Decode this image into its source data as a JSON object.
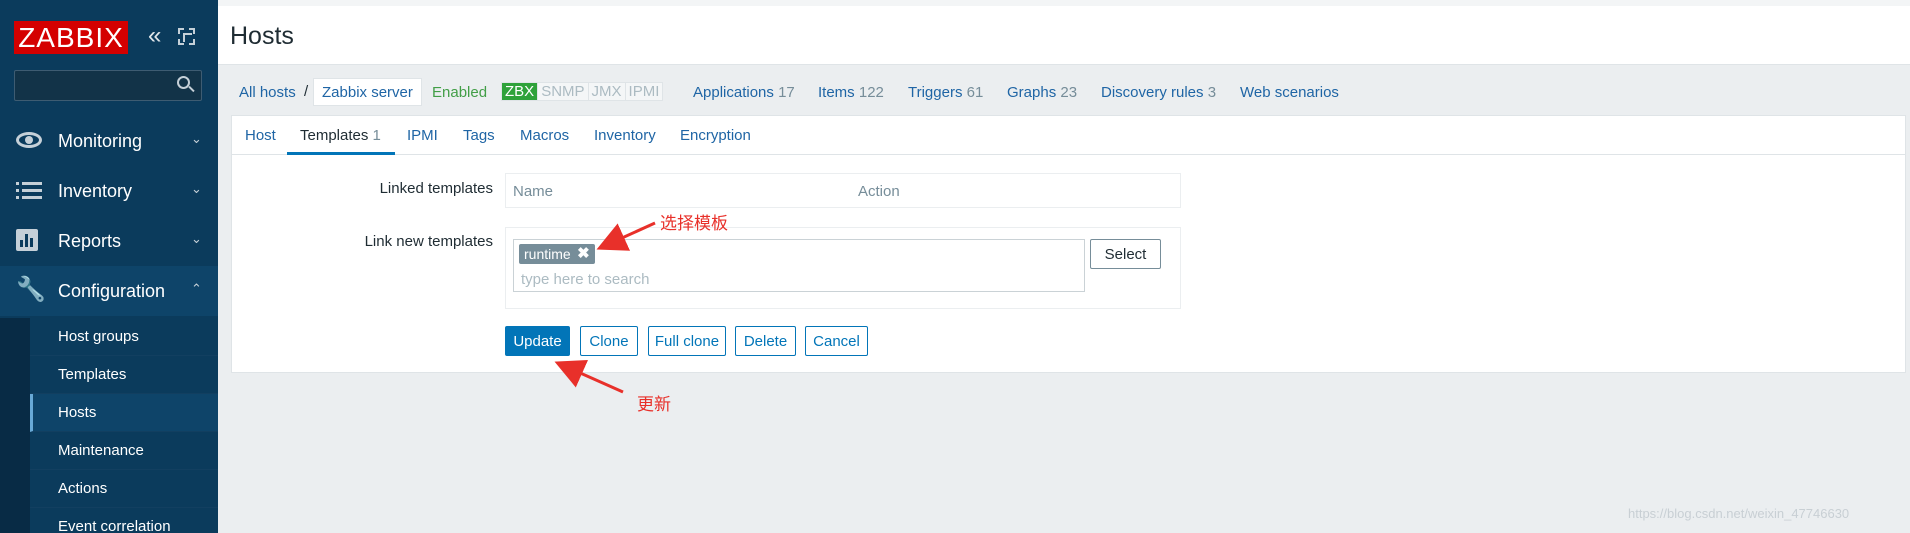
{
  "logo": "ZABBIX",
  "sidebar": {
    "menu": [
      {
        "label": "Monitoring",
        "chevron": "⌄"
      },
      {
        "label": "Inventory",
        "chevron": "⌄"
      },
      {
        "label": "Reports",
        "chevron": "⌄"
      },
      {
        "label": "Configuration",
        "chevron": "⌃"
      }
    ],
    "submenu": [
      "Host groups",
      "Templates",
      "Hosts",
      "Maintenance",
      "Actions",
      "Event correlation"
    ]
  },
  "header": {
    "title": "Hosts"
  },
  "hostnav": {
    "all_hosts": "All hosts",
    "separator": "/",
    "current": "Zabbix server",
    "status": "Enabled",
    "availability": [
      "ZBX",
      "SNMP",
      "JMX",
      "IPMI"
    ],
    "links": [
      {
        "label": "Applications",
        "count": "17"
      },
      {
        "label": "Items",
        "count": "122"
      },
      {
        "label": "Triggers",
        "count": "61"
      },
      {
        "label": "Graphs",
        "count": "23"
      },
      {
        "label": "Discovery rules",
        "count": "3"
      },
      {
        "label": "Web scenarios",
        "count": ""
      }
    ]
  },
  "tabs": {
    "host": "Host",
    "templates": "Templates",
    "templates_count": "1",
    "ipmi": "IPMI",
    "tags": "Tags",
    "macros": "Macros",
    "inventory": "Inventory",
    "encryption": "Encryption"
  },
  "form": {
    "linked_templates_label": "Linked templates",
    "col_name": "Name",
    "col_action": "Action",
    "link_new_label": "Link new templates",
    "chip": "runtime",
    "chip_remove": "✖",
    "search_placeholder": "type here to search",
    "select_button": "Select"
  },
  "buttons": {
    "update": "Update",
    "clone": "Clone",
    "full_clone": "Full clone",
    "delete": "Delete",
    "cancel": "Cancel"
  },
  "annotations": {
    "select_template": "选择模板",
    "update": "更新"
  },
  "watermark": "https://blog.csdn.net/weixin_47746630",
  "colors": {
    "sidebar": "#0b3b5c",
    "logo": "#d40000",
    "link": "#1f65a5",
    "primary": "#0275b8",
    "annotation": "#e8302a"
  }
}
